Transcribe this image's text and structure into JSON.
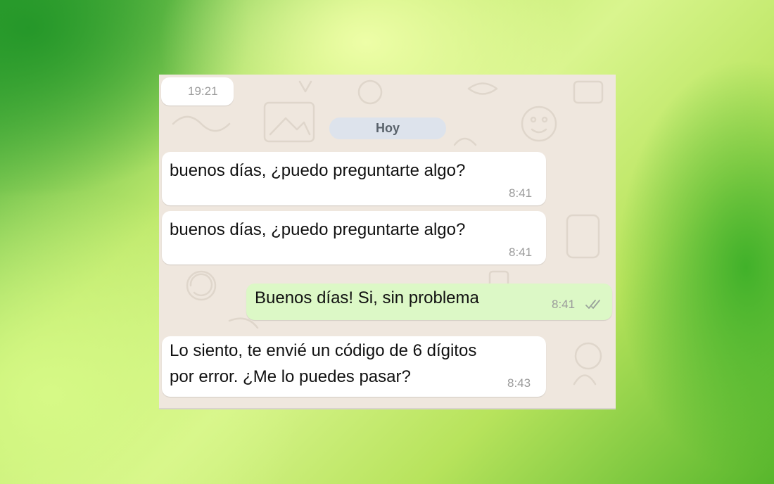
{
  "chat": {
    "prev_time": "19:21",
    "date_label": "Hoy",
    "messages": [
      {
        "direction": "incoming",
        "text": "buenos días, ¿puedo preguntarte algo?",
        "time": "8:41"
      },
      {
        "direction": "incoming",
        "text": "buenos días, ¿puedo preguntarte algo?",
        "time": "8:41"
      },
      {
        "direction": "outgoing",
        "text": "Buenos días! Si, sin problema",
        "time": "8:41",
        "status": "read-ticks-icon"
      },
      {
        "direction": "incoming",
        "lines": [
          "Lo siento, te envié un código de 6 dígitos",
          "por error. ¿Me lo puedes pasar?"
        ],
        "time": "8:43"
      }
    ]
  },
  "colors": {
    "chat_bg": "#efe7de",
    "incoming_bubble": "#ffffff",
    "outgoing_bubble": "#dcf8c6",
    "date_chip": "#dde3ec",
    "time_text": "#9b9b9b"
  }
}
